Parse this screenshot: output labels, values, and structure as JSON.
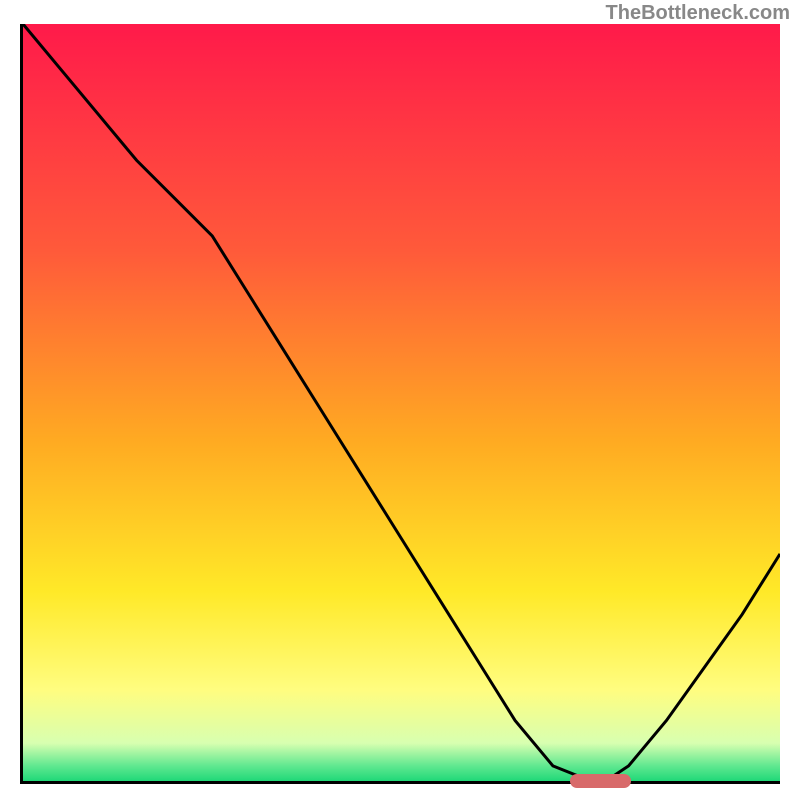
{
  "watermark": "TheBottleneck.com",
  "chart_data": {
    "type": "line",
    "title": "",
    "xlabel": "",
    "ylabel": "",
    "xlim": [
      0,
      100
    ],
    "ylim": [
      0,
      100
    ],
    "grid": false,
    "series": [
      {
        "name": "curve",
        "x": [
          0,
          5,
          10,
          15,
          20,
          25,
          30,
          35,
          40,
          45,
          50,
          55,
          60,
          65,
          70,
          75,
          77,
          80,
          85,
          90,
          95,
          100
        ],
        "y": [
          100,
          94,
          88,
          82,
          77,
          72,
          64,
          56,
          48,
          40,
          32,
          24,
          16,
          8,
          2,
          0,
          0,
          2,
          8,
          15,
          22,
          30
        ]
      }
    ],
    "gradient_stops": [
      {
        "pos": 0.0,
        "color": "#ff1a4a"
      },
      {
        "pos": 0.3,
        "color": "#ff5a3a"
      },
      {
        "pos": 0.55,
        "color": "#ffaa22"
      },
      {
        "pos": 0.75,
        "color": "#ffe928"
      },
      {
        "pos": 0.88,
        "color": "#fffd80"
      },
      {
        "pos": 0.95,
        "color": "#d8ffb0"
      },
      {
        "pos": 0.98,
        "color": "#60e890"
      },
      {
        "pos": 1.0,
        "color": "#20d878"
      }
    ],
    "marker": {
      "x_start": 72,
      "x_end": 80,
      "y": 0,
      "color": "#d86a6a"
    }
  }
}
